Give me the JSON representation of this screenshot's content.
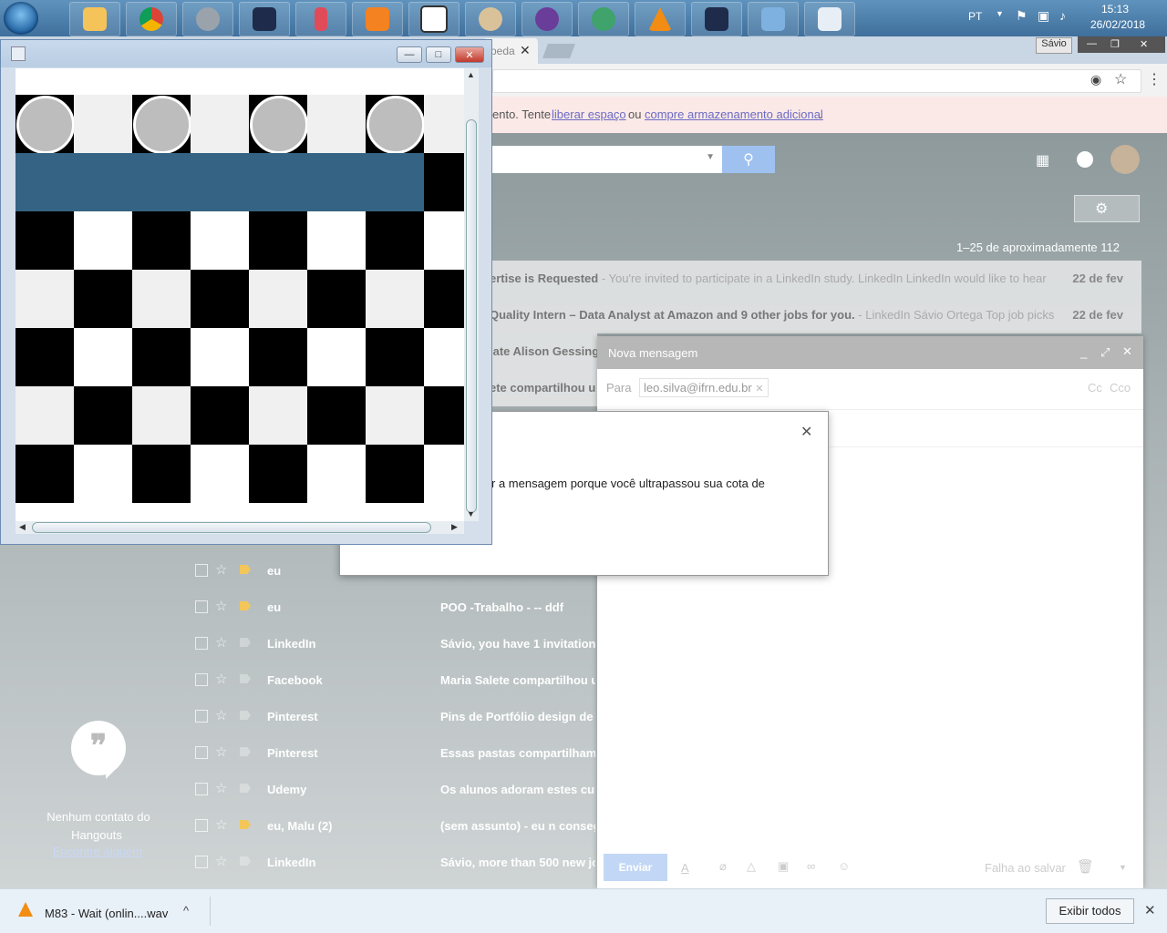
{
  "taskbar": {
    "language": "PT",
    "time": "15:13",
    "date": "26/02/2018",
    "user_chip": "Sávio"
  },
  "chrome": {
    "tab_partial": "peda"
  },
  "gmail": {
    "storage_warning": {
      "prefix": "ento. Tente",
      "link1": "liberar espaço",
      "mid": "ou",
      "link2": "compre armazenamento adicional",
      "suffix": "."
    },
    "pagination": "1–25 de aproximadamente 112",
    "top_rows": [
      {
        "subject": "ertise is Requested",
        "preview": " - You're invited to participate in a LinkedIn study. LinkedIn LinkedIn would like to hear",
        "date": "22 de fev"
      },
      {
        "subject": "Quality Intern – Data Analyst at Amazon and 9 other jobs for you.",
        "preview": " - LinkedIn Sávio Ortega Top job picks",
        "date": "22 de fev"
      },
      {
        "subject": "late Alison Gessing",
        "preview": "",
        "date": ""
      },
      {
        "subject": "ete compartilhou u",
        "preview": "",
        "date": ""
      }
    ],
    "rows": [
      {
        "sender": "eu",
        "subject": "",
        "yellow": true
      },
      {
        "sender": "eu",
        "subject": "POO -Trabalho - -- ddf",
        "yellow": true
      },
      {
        "sender": "LinkedIn",
        "subject": "Sávio, you have 1 invitation,",
        "yellow": false
      },
      {
        "sender": "Facebook",
        "subject": "Maria Salete compartilhou u",
        "yellow": false
      },
      {
        "sender": "Pinterest",
        "subject": "Pins de Portfólio design de r",
        "yellow": false
      },
      {
        "sender": "Pinterest",
        "subject": "Essas pastas compartilham",
        "yellow": false
      },
      {
        "sender": "Udemy",
        "subject": "Os alunos adoram estes cur",
        "yellow": false
      },
      {
        "sender": "eu, Malu (2)",
        "subject": "(sem assunto) - eu n consegu",
        "yellow": true
      },
      {
        "sender": "LinkedIn",
        "subject": "Sávio, more than 500 new jo",
        "yellow": false
      }
    ],
    "hangouts": {
      "empty_line1": "Nenhum contato do",
      "empty_line2": "Hangouts",
      "find_link": "Encontre alguém"
    }
  },
  "compose": {
    "title": "Nova mensagem",
    "to_label": "Para",
    "recipient": "leo.silva@ifrn.edu.br",
    "cc": "Cc",
    "bcc": "Cco",
    "send": "Enviar",
    "status": "Falha ao salvar"
  },
  "dialog": {
    "message": "r a mensagem porque você ultrapassou sua cota de"
  },
  "download": {
    "filename": "M83 - Wait (onlin....wav",
    "show_all": "Exibir todos"
  },
  "board": {
    "rows": 7,
    "cols": 8,
    "pieces_row": 1,
    "pieces_cols": [
      0,
      2,
      4,
      6
    ],
    "selected_row": 2
  }
}
